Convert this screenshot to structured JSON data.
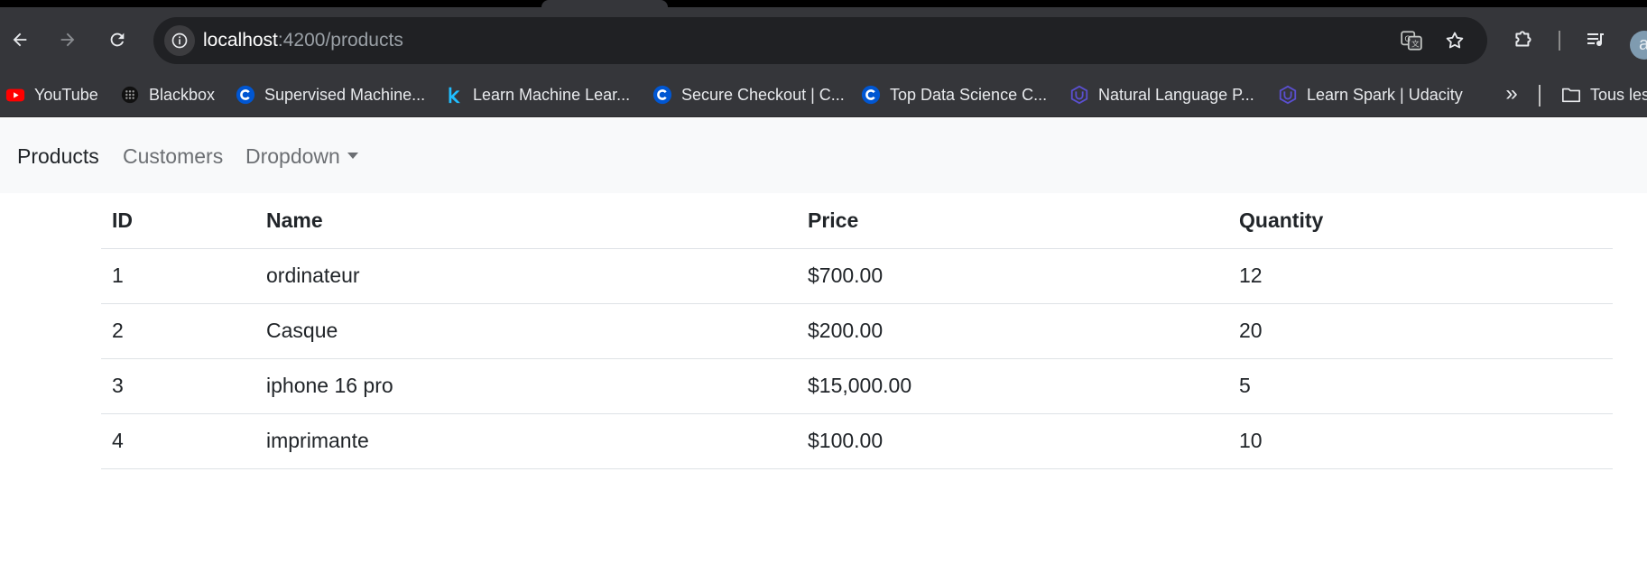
{
  "browser": {
    "url_host": "localhost",
    "url_path": ":4200/products",
    "avatar_letter": "a",
    "bookmarks": [
      {
        "label": "YouTube",
        "icon": "youtube-icon"
      },
      {
        "label": "Blackbox",
        "icon": "blackbox-icon"
      },
      {
        "label": "Supervised Machine...",
        "icon": "coursera-icon"
      },
      {
        "label": "Learn Machine Lear...",
        "icon": "kaggle-icon"
      },
      {
        "label": "Secure Checkout | C...",
        "icon": "coursera-icon"
      },
      {
        "label": "Top Data Science C...",
        "icon": "coursera-icon"
      },
      {
        "label": "Natural Language P...",
        "icon": "udacity-icon"
      },
      {
        "label": "Learn Spark | Udacity",
        "icon": "udacity-icon"
      }
    ],
    "more_bookmarks": "»",
    "all_bookmarks_label": "Tous les"
  },
  "navbar": {
    "links": [
      {
        "label": "Products",
        "active": true
      },
      {
        "label": "Customers",
        "active": false
      },
      {
        "label": "Dropdown",
        "active": false
      }
    ]
  },
  "table": {
    "headers": [
      "ID",
      "Name",
      "Price",
      "Quantity"
    ],
    "rows": [
      [
        "1",
        "ordinateur",
        "$700.00",
        "12"
      ],
      [
        "2",
        "Casque",
        "$200.00",
        "20"
      ],
      [
        "3",
        "iphone 16 pro",
        "$15,000.00",
        "5"
      ],
      [
        "4",
        "imprimante",
        "$100.00",
        "10"
      ]
    ]
  },
  "colors": {
    "chrome_bg": "#35363a",
    "omnibox_bg": "#202124",
    "navbar_bg": "#f8f9fa",
    "text_primary": "#212529",
    "text_muted": "#6c6f73"
  }
}
